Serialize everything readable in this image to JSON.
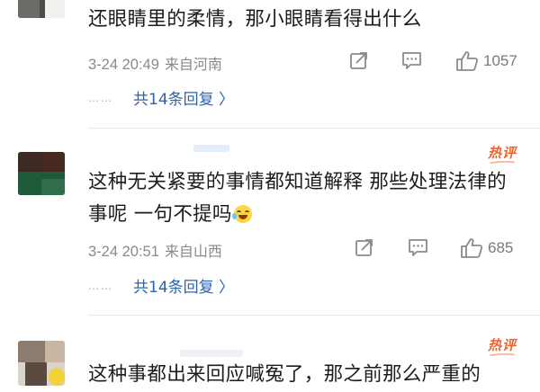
{
  "colors": {
    "link": "#2d64a8",
    "meta": "#8a8a8a",
    "hot_badge": "#f0632a",
    "divider": "#e7e7e7"
  },
  "comments": [
    {
      "text": "还眼睛里的柔情，那小眼睛看得出什么",
      "time": "3-24 20:49",
      "location": "来自河南",
      "likes": "1057",
      "replies_dots": "……",
      "replies_label": "共14条回复 〉",
      "hot_badge": "",
      "icons": [
        "share-icon",
        "comment-icon",
        "thumbs-up-icon"
      ]
    },
    {
      "text": "这种无关紧要的事情都知道解释 那些处理法律的事呢 一句不提吗",
      "time": "3-24 20:51",
      "location": "来自山西",
      "likes": "685",
      "replies_dots": "……",
      "replies_label": "共14条回复 〉",
      "hot_badge": "热评",
      "icons": [
        "share-icon",
        "comment-icon",
        "thumbs-up-icon"
      ]
    },
    {
      "text": "这种事都出来回应喊冤了，那之前那么严重的",
      "hot_badge": "热评"
    }
  ]
}
